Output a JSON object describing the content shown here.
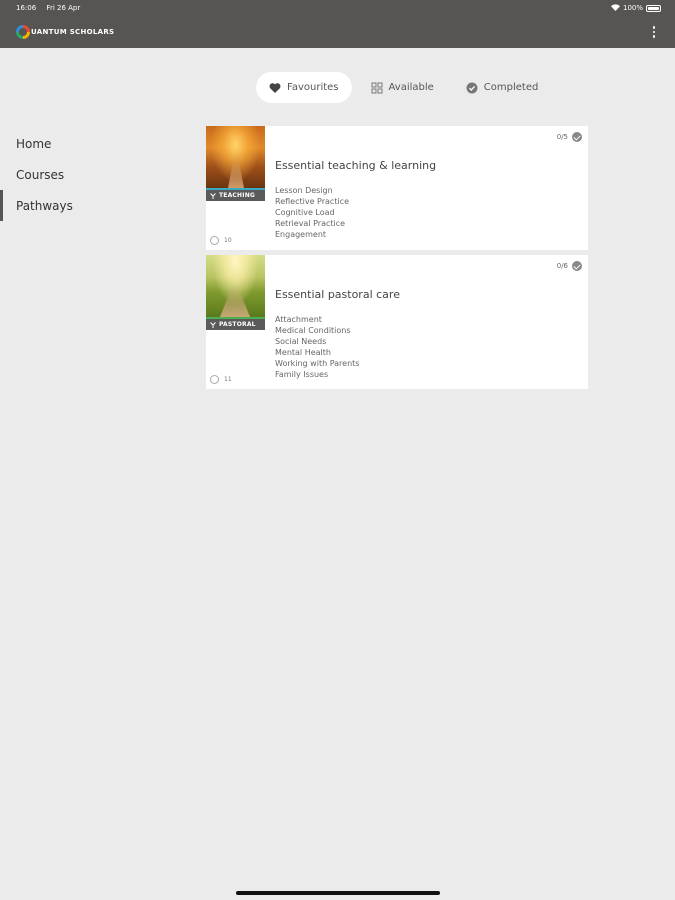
{
  "status_bar": {
    "time": "16:06",
    "date": "Fri 26 Apr",
    "battery": "100%"
  },
  "app": {
    "brand": "UANTUM SCHOLARS"
  },
  "filters": [
    {
      "label": "Favourites",
      "icon": "heart-icon",
      "active": true
    },
    {
      "label": "Available",
      "icon": "grid-icon",
      "active": false
    },
    {
      "label": "Completed",
      "icon": "check-circle-icon",
      "active": false
    }
  ],
  "sidebar": {
    "items": [
      {
        "label": "Home"
      },
      {
        "label": "Courses"
      },
      {
        "label": "Pathways",
        "active": true
      }
    ]
  },
  "pathways": [
    {
      "title": "Essential teaching & learning",
      "tag": "TEACHING",
      "progress": "0/5",
      "course_count": "10",
      "topics": [
        "Lesson Design",
        "Reflective Practice",
        "Cognitive Load",
        "Retrieval Practice",
        "Engagement"
      ]
    },
    {
      "title": "Essential pastoral care",
      "tag": "PASTORAL",
      "progress": "0/6",
      "course_count": "11",
      "topics": [
        "Attachment",
        "Medical Conditions",
        "Social Needs",
        "Mental Health",
        "Working with Parents",
        "Family Issues"
      ]
    }
  ],
  "colors": {
    "header_bg": "#575553",
    "page_bg": "#ebebeb",
    "teaching_accent": "#3aa9c4",
    "pastoral_accent": "#4caf50"
  }
}
